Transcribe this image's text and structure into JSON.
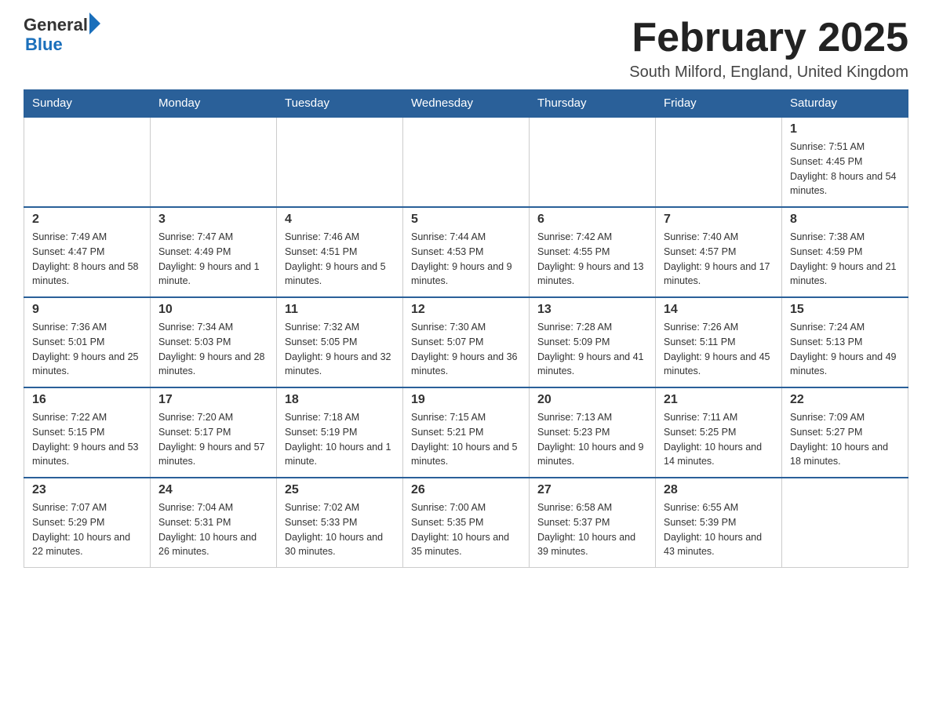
{
  "header": {
    "logo_line1": "General",
    "logo_line2": "Blue",
    "month_title": "February 2025",
    "location": "South Milford, England, United Kingdom"
  },
  "weekdays": [
    "Sunday",
    "Monday",
    "Tuesday",
    "Wednesday",
    "Thursday",
    "Friday",
    "Saturday"
  ],
  "weeks": [
    [
      {
        "day": "",
        "info": ""
      },
      {
        "day": "",
        "info": ""
      },
      {
        "day": "",
        "info": ""
      },
      {
        "day": "",
        "info": ""
      },
      {
        "day": "",
        "info": ""
      },
      {
        "day": "",
        "info": ""
      },
      {
        "day": "1",
        "info": "Sunrise: 7:51 AM\nSunset: 4:45 PM\nDaylight: 8 hours and 54 minutes."
      }
    ],
    [
      {
        "day": "2",
        "info": "Sunrise: 7:49 AM\nSunset: 4:47 PM\nDaylight: 8 hours and 58 minutes."
      },
      {
        "day": "3",
        "info": "Sunrise: 7:47 AM\nSunset: 4:49 PM\nDaylight: 9 hours and 1 minute."
      },
      {
        "day": "4",
        "info": "Sunrise: 7:46 AM\nSunset: 4:51 PM\nDaylight: 9 hours and 5 minutes."
      },
      {
        "day": "5",
        "info": "Sunrise: 7:44 AM\nSunset: 4:53 PM\nDaylight: 9 hours and 9 minutes."
      },
      {
        "day": "6",
        "info": "Sunrise: 7:42 AM\nSunset: 4:55 PM\nDaylight: 9 hours and 13 minutes."
      },
      {
        "day": "7",
        "info": "Sunrise: 7:40 AM\nSunset: 4:57 PM\nDaylight: 9 hours and 17 minutes."
      },
      {
        "day": "8",
        "info": "Sunrise: 7:38 AM\nSunset: 4:59 PM\nDaylight: 9 hours and 21 minutes."
      }
    ],
    [
      {
        "day": "9",
        "info": "Sunrise: 7:36 AM\nSunset: 5:01 PM\nDaylight: 9 hours and 25 minutes."
      },
      {
        "day": "10",
        "info": "Sunrise: 7:34 AM\nSunset: 5:03 PM\nDaylight: 9 hours and 28 minutes."
      },
      {
        "day": "11",
        "info": "Sunrise: 7:32 AM\nSunset: 5:05 PM\nDaylight: 9 hours and 32 minutes."
      },
      {
        "day": "12",
        "info": "Sunrise: 7:30 AM\nSunset: 5:07 PM\nDaylight: 9 hours and 36 minutes."
      },
      {
        "day": "13",
        "info": "Sunrise: 7:28 AM\nSunset: 5:09 PM\nDaylight: 9 hours and 41 minutes."
      },
      {
        "day": "14",
        "info": "Sunrise: 7:26 AM\nSunset: 5:11 PM\nDaylight: 9 hours and 45 minutes."
      },
      {
        "day": "15",
        "info": "Sunrise: 7:24 AM\nSunset: 5:13 PM\nDaylight: 9 hours and 49 minutes."
      }
    ],
    [
      {
        "day": "16",
        "info": "Sunrise: 7:22 AM\nSunset: 5:15 PM\nDaylight: 9 hours and 53 minutes."
      },
      {
        "day": "17",
        "info": "Sunrise: 7:20 AM\nSunset: 5:17 PM\nDaylight: 9 hours and 57 minutes."
      },
      {
        "day": "18",
        "info": "Sunrise: 7:18 AM\nSunset: 5:19 PM\nDaylight: 10 hours and 1 minute."
      },
      {
        "day": "19",
        "info": "Sunrise: 7:15 AM\nSunset: 5:21 PM\nDaylight: 10 hours and 5 minutes."
      },
      {
        "day": "20",
        "info": "Sunrise: 7:13 AM\nSunset: 5:23 PM\nDaylight: 10 hours and 9 minutes."
      },
      {
        "day": "21",
        "info": "Sunrise: 7:11 AM\nSunset: 5:25 PM\nDaylight: 10 hours and 14 minutes."
      },
      {
        "day": "22",
        "info": "Sunrise: 7:09 AM\nSunset: 5:27 PM\nDaylight: 10 hours and 18 minutes."
      }
    ],
    [
      {
        "day": "23",
        "info": "Sunrise: 7:07 AM\nSunset: 5:29 PM\nDaylight: 10 hours and 22 minutes."
      },
      {
        "day": "24",
        "info": "Sunrise: 7:04 AM\nSunset: 5:31 PM\nDaylight: 10 hours and 26 minutes."
      },
      {
        "day": "25",
        "info": "Sunrise: 7:02 AM\nSunset: 5:33 PM\nDaylight: 10 hours and 30 minutes."
      },
      {
        "day": "26",
        "info": "Sunrise: 7:00 AM\nSunset: 5:35 PM\nDaylight: 10 hours and 35 minutes."
      },
      {
        "day": "27",
        "info": "Sunrise: 6:58 AM\nSunset: 5:37 PM\nDaylight: 10 hours and 39 minutes."
      },
      {
        "day": "28",
        "info": "Sunrise: 6:55 AM\nSunset: 5:39 PM\nDaylight: 10 hours and 43 minutes."
      },
      {
        "day": "",
        "info": ""
      }
    ]
  ]
}
